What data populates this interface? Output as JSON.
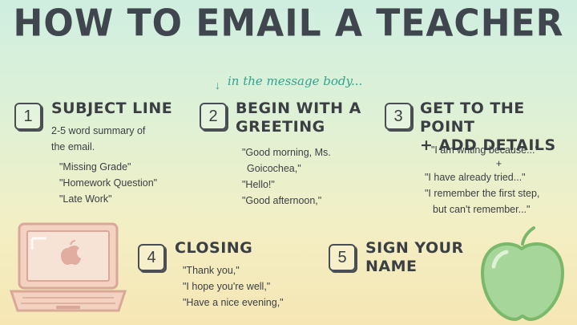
{
  "title": "HOW TO EMAIL A TEACHER",
  "note": "in the message body...",
  "steps": [
    {
      "number": "1",
      "heading": "SUBJECT LINE",
      "lines": [
        "2-5 word summary of",
        "the email."
      ],
      "examples": [
        "\"Missing Grade\"",
        "\"Homework Question\"",
        "\"Late Work\""
      ]
    },
    {
      "number": "2",
      "heading_line1": "BEGIN WITH A",
      "heading_line2": "GREETING",
      "examples": [
        "\"Good morning, Ms.",
        "Goicochea,\"",
        "\"Hello!\"",
        "\"Good afternoon,\""
      ]
    },
    {
      "number": "3",
      "heading_line1": "GET TO THE POINT",
      "heading_line2": "+ ADD DETAILS",
      "examples": [
        "\"I am writing because...\"",
        "+",
        "\"I have already tried...\"",
        "\"I remember the first step,",
        "but can't remember...\""
      ]
    },
    {
      "number": "4",
      "heading": "CLOSING",
      "examples": [
        "\"Thank you,\"",
        "\"I hope you're well,\"",
        "\"Have a nice evening,\""
      ]
    },
    {
      "number": "5",
      "heading_line1": "SIGN YOUR",
      "heading_line2": "NAME"
    }
  ],
  "colors": {
    "accent": "#2fa58f",
    "text": "#3b3f44",
    "laptop": "#e8b7a6",
    "apple": "#9fcf8f"
  }
}
